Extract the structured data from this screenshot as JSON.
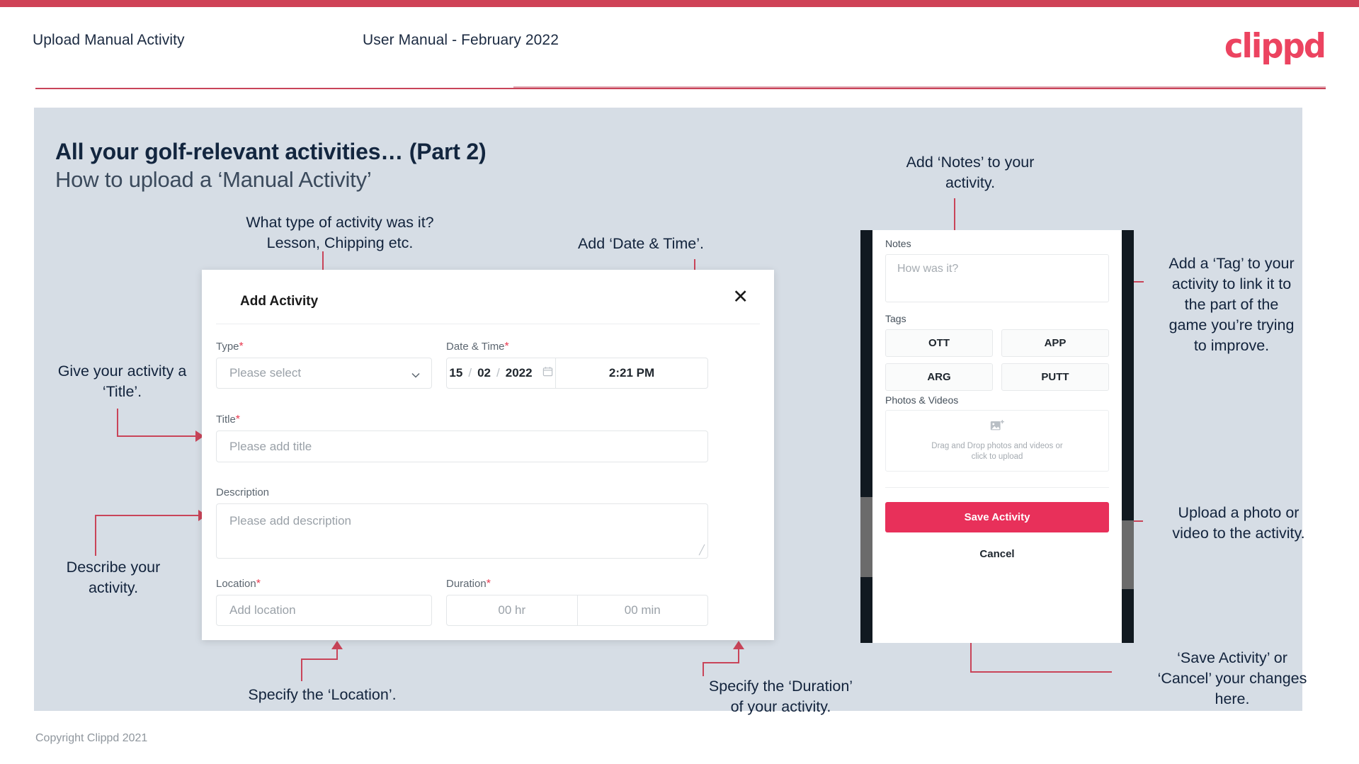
{
  "header": {
    "title": "Upload Manual Activity",
    "subtitle": "User Manual - February 2022",
    "logo": "clippd"
  },
  "slide": {
    "title_bold": "All your golf-relevant activities… (Part 2)",
    "title_light": "How to upload a ‘Manual Activity’"
  },
  "annotations": {
    "type": "What type of activity was it?\nLesson, Chipping etc.",
    "datetime": "Add ‘Date & Time’.",
    "title": "Give your activity a\n‘Title’.",
    "description": "Describe your\nactivity.",
    "location": "Specify the ‘Location’.",
    "duration": "Specify the ‘Duration’\nof your activity.",
    "notes": "Add ‘Notes’ to your\nactivity.",
    "tags": "Add a ‘Tag’ to your\nactivity to link it to\nthe part of the\ngame you’re trying\nto improve.",
    "upload": "Upload a photo or\nvideo to the activity.",
    "save": "‘Save Activity’ or\n‘Cancel’ your changes\nhere."
  },
  "dialog": {
    "title": "Add Activity",
    "close_icon": "close-icon",
    "fields": {
      "type_label": "Type",
      "type_placeholder": "Please select",
      "datetime_label": "Date & Time",
      "date_day": "15",
      "date_month": "02",
      "date_year": "2022",
      "date_sep": "/",
      "time_value": "2:21 PM",
      "title_label": "Title",
      "title_placeholder": "Please add title",
      "description_label": "Description",
      "description_placeholder": "Please add description",
      "location_label": "Location",
      "location_placeholder": "Add location",
      "duration_label": "Duration",
      "duration_hr": "00 hr",
      "duration_min": "00 min"
    },
    "required_marker": "*"
  },
  "phone": {
    "notes_label": "Notes",
    "notes_placeholder": "How was it?",
    "tags_label": "Tags",
    "tags": [
      "OTT",
      "APP",
      "ARG",
      "PUTT"
    ],
    "photos_label": "Photos & Videos",
    "dropzone_line1": "Drag and Drop photos and videos or",
    "dropzone_line2": "click to upload",
    "save_label": "Save Activity",
    "cancel_label": "Cancel"
  },
  "footer": {
    "copyright": "Copyright Clippd 2021"
  },
  "colors": {
    "accent": "#e8305a",
    "brand_red": "#c94459",
    "panel_bg": "#d6dde5",
    "text_dark": "#12233c"
  }
}
